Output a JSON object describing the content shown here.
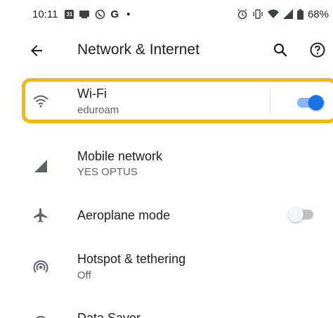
{
  "status_bar": {
    "time": "10:11",
    "calendar_day": "31",
    "g_label": "G",
    "dot": "•",
    "battery_pct": "68%"
  },
  "toolbar": {
    "title": "Network & Internet"
  },
  "settings": [
    {
      "label": "Wi-Fi",
      "sub": "eduroam",
      "icon": "wifi-icon",
      "toggle_on": true
    },
    {
      "label": "Mobile network",
      "sub": "YES OPTUS",
      "icon": "signal-icon"
    },
    {
      "label": "Aeroplane mode",
      "sub": "",
      "icon": "airplane-icon",
      "toggle_on": false
    },
    {
      "label": "Hotspot & tethering",
      "sub": "Off",
      "icon": "hotspot-icon"
    },
    {
      "label": "Data Saver",
      "sub": "",
      "icon": "data-saver-icon"
    }
  ],
  "colors": {
    "highlight": "#f6b800",
    "accent": "#1a73e8"
  }
}
